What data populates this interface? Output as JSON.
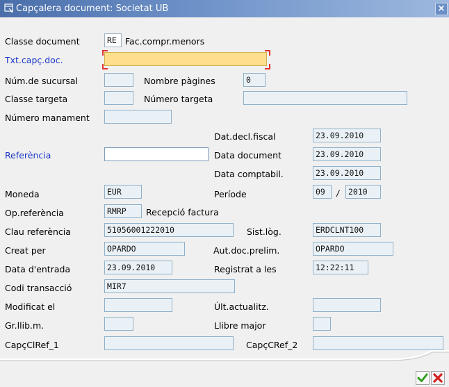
{
  "window": {
    "title": "Capçalera document: Societat UB",
    "close_glyph": "×"
  },
  "fields": {
    "classe_document": {
      "label": "Classe document",
      "value": "RE",
      "description": "Fac.compr.menors"
    },
    "txt_capc_doc": {
      "label": "Txt.capç.doc.",
      "value": ""
    },
    "num_sucursal": {
      "label": "Núm.de sucursal",
      "value": ""
    },
    "nombre_pagines": {
      "label": "Nombre pàgines",
      "value": "0"
    },
    "classe_targeta": {
      "label": "Classe targeta",
      "value": ""
    },
    "numero_targeta": {
      "label": "Número targeta",
      "value": ""
    },
    "numero_manament": {
      "label": "Número manament",
      "value": ""
    },
    "dat_decl_fiscal": {
      "label": "Dat.decl.fiscal",
      "value": "23.09.2010"
    },
    "referencia": {
      "label": "Referència",
      "value": ""
    },
    "data_document": {
      "label": "Data document",
      "value": "23.09.2010"
    },
    "data_comptabil": {
      "label": "Data comptabil.",
      "value": "23.09.2010"
    },
    "moneda": {
      "label": "Moneda",
      "value": "EUR"
    },
    "periode": {
      "label": "Període",
      "month": "09",
      "separator": "/",
      "year": "2010"
    },
    "op_referencia": {
      "label": "Op.referència",
      "value": "RMRP",
      "description": "Recepció factura"
    },
    "clau_referencia": {
      "label": "Clau referència",
      "value": "51056001222010"
    },
    "sist_log": {
      "label": "Sist.lòg.",
      "value": "ERDCLNT100"
    },
    "creat_per": {
      "label": "Creat per",
      "value": "OPARDO"
    },
    "aut_doc_prelim": {
      "label": "Aut.doc.prelim.",
      "value": "OPARDO"
    },
    "data_entrada": {
      "label": "Data d'entrada",
      "value": "23.09.2010"
    },
    "registrat_a_les": {
      "label": "Registrat a les",
      "value": "12:22:11"
    },
    "codi_transaccio": {
      "label": "Codi transacció",
      "value": "MIR7"
    },
    "modificat_el": {
      "label": "Modificat el",
      "value": ""
    },
    "ult_actualitz": {
      "label": "Últ.actualitz.",
      "value": ""
    },
    "gr_llib_m": {
      "label": "Gr.llib.m.",
      "value": ""
    },
    "llibre_major": {
      "label": "Llibre major",
      "value": ""
    },
    "capc_cl_ref_1": {
      "label": "CapçClRef_1",
      "value": ""
    },
    "capc_c_ref_2": {
      "label": "CapçCRef_2",
      "value": ""
    }
  },
  "buttons": {
    "confirm": "✔",
    "cancel": "✖"
  },
  "colors": {
    "link": "#1a37c8",
    "focus_field": "#ffdf8e",
    "confirm": "#2f9e1c",
    "cancel": "#d42020"
  }
}
